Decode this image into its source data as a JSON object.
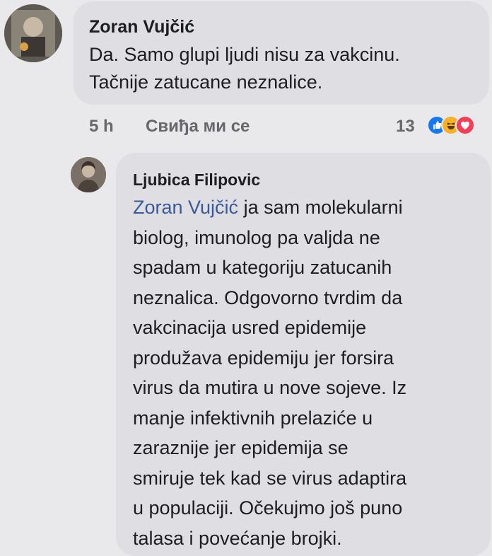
{
  "comment1": {
    "author": "Zoran Vujčić",
    "text": "Da. Samo glupi ljudi nisu za vakcinu.\nTačnije zatucane neznalice.",
    "time": "5 h",
    "like_label": "Свиђа ми се",
    "reaction_count": "13",
    "reaction_icons": [
      "like-icon",
      "haha-icon",
      "love-icon"
    ]
  },
  "reply1": {
    "author": "Ljubica Filipovic",
    "mention": "Zoran Vujčić",
    "text": " ja sam molekularni\nbiolog, imunolog pa valjda ne\nspadam u kategoriju zatucanih\nneznalica. Odgovorno tvrdim da\nvakcinacija usred epidemije\nprodužava epidemiju jer forsira\nvirus da mutira u nove sojeve. Iz\nmanje infektivnih prelaziće u\nzaraznije jer epidemija se\nsmiruje tek kad se virus adaptira\nu populaciji. Očekujmo još puno\ntalasa i povećanje brojki."
  },
  "colors": {
    "background": "#e9e9ec",
    "bubble": "#dfdfe3",
    "mention": "#3b5a9a",
    "like": "#1877f2",
    "haha": "#f7b125",
    "love": "#f33e58"
  }
}
